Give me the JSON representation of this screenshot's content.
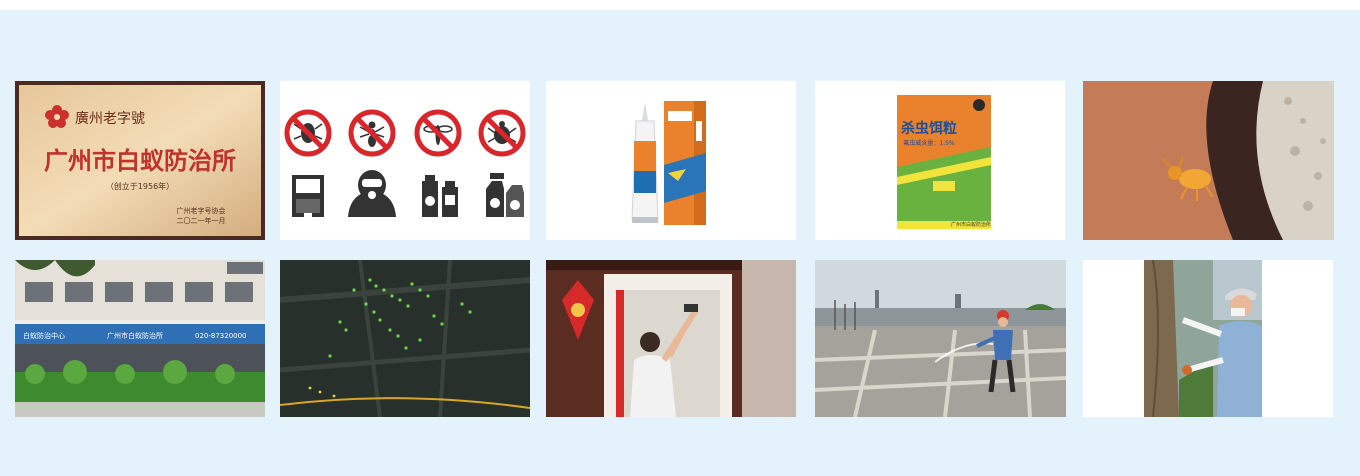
{
  "plaque": {
    "badge": "廣州老字號",
    "title": "广州市白蚁防治所",
    "subtitle": "（创立于1956年）",
    "issuer": "广州老字号协会",
    "date": "二〇二一年一月"
  },
  "bait_box": {
    "title": "杀虫饵粒",
    "subtitle": "氟虫威含量：1.5%",
    "brand": "广州市白蚁防治所"
  },
  "storefront": {
    "signs": [
      "白蚁防治中心",
      "广州市白蚁防治所",
      "020-87320000"
    ]
  },
  "colors": {
    "panel_bg": "#e4f3fb",
    "prohibit_red": "#d8262b",
    "product_orange": "#e9812d",
    "bait_green": "#6ab23f"
  }
}
